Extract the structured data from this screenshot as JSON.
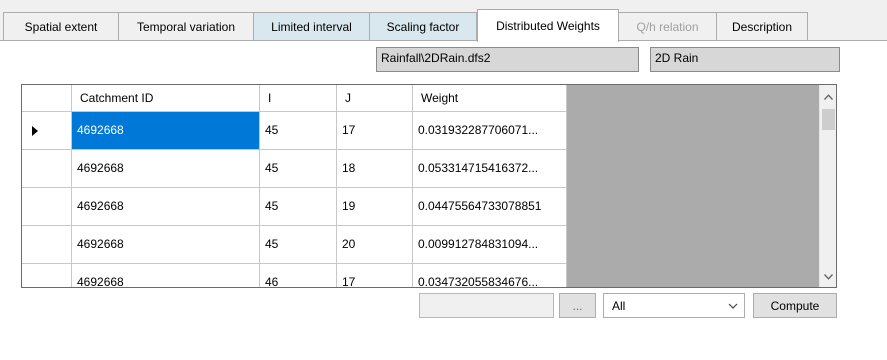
{
  "tabs": [
    {
      "label": "Spatial extent",
      "state": "normal"
    },
    {
      "label": "Temporal variation",
      "state": "normal"
    },
    {
      "label": "Limited interval",
      "state": "tinted"
    },
    {
      "label": "Scaling factor",
      "state": "tinted"
    },
    {
      "label": "Distributed Weights",
      "state": "active"
    },
    {
      "label": "Q/h relation",
      "state": "disabled"
    },
    {
      "label": "Description",
      "state": "normal"
    }
  ],
  "source": {
    "file": "Rainfall\\2DRain.dfs2",
    "item": "2D Rain"
  },
  "grid": {
    "columns": [
      "Catchment ID",
      "I",
      "J",
      "Weight"
    ],
    "rows": [
      {
        "id": "4692668",
        "i": "45",
        "j": "17",
        "weight": "0.031932287706071...",
        "selected": true
      },
      {
        "id": "4692668",
        "i": "45",
        "j": "18",
        "weight": "0.053314715416372..."
      },
      {
        "id": "4692668",
        "i": "45",
        "j": "19",
        "weight": "0.04475564733078851"
      },
      {
        "id": "4692668",
        "i": "45",
        "j": "20",
        "weight": "0.009912784831094..."
      },
      {
        "id": "4692668",
        "i": "46",
        "j": "17",
        "weight": "0.034732055834676..."
      }
    ]
  },
  "controls": {
    "path_value": "",
    "browse_label": "...",
    "filter_value": "All",
    "compute_label": "Compute"
  },
  "icons": {
    "row_pointer": "row-pointer-icon",
    "scroll_up": "chevron-up-icon",
    "scroll_down": "chevron-down-icon",
    "combo_arrow": "chevron-down-icon"
  },
  "colors": {
    "selection": "#0078d7",
    "tab_tint": "#d9e7ee",
    "grid_empty_area": "#ababab"
  }
}
